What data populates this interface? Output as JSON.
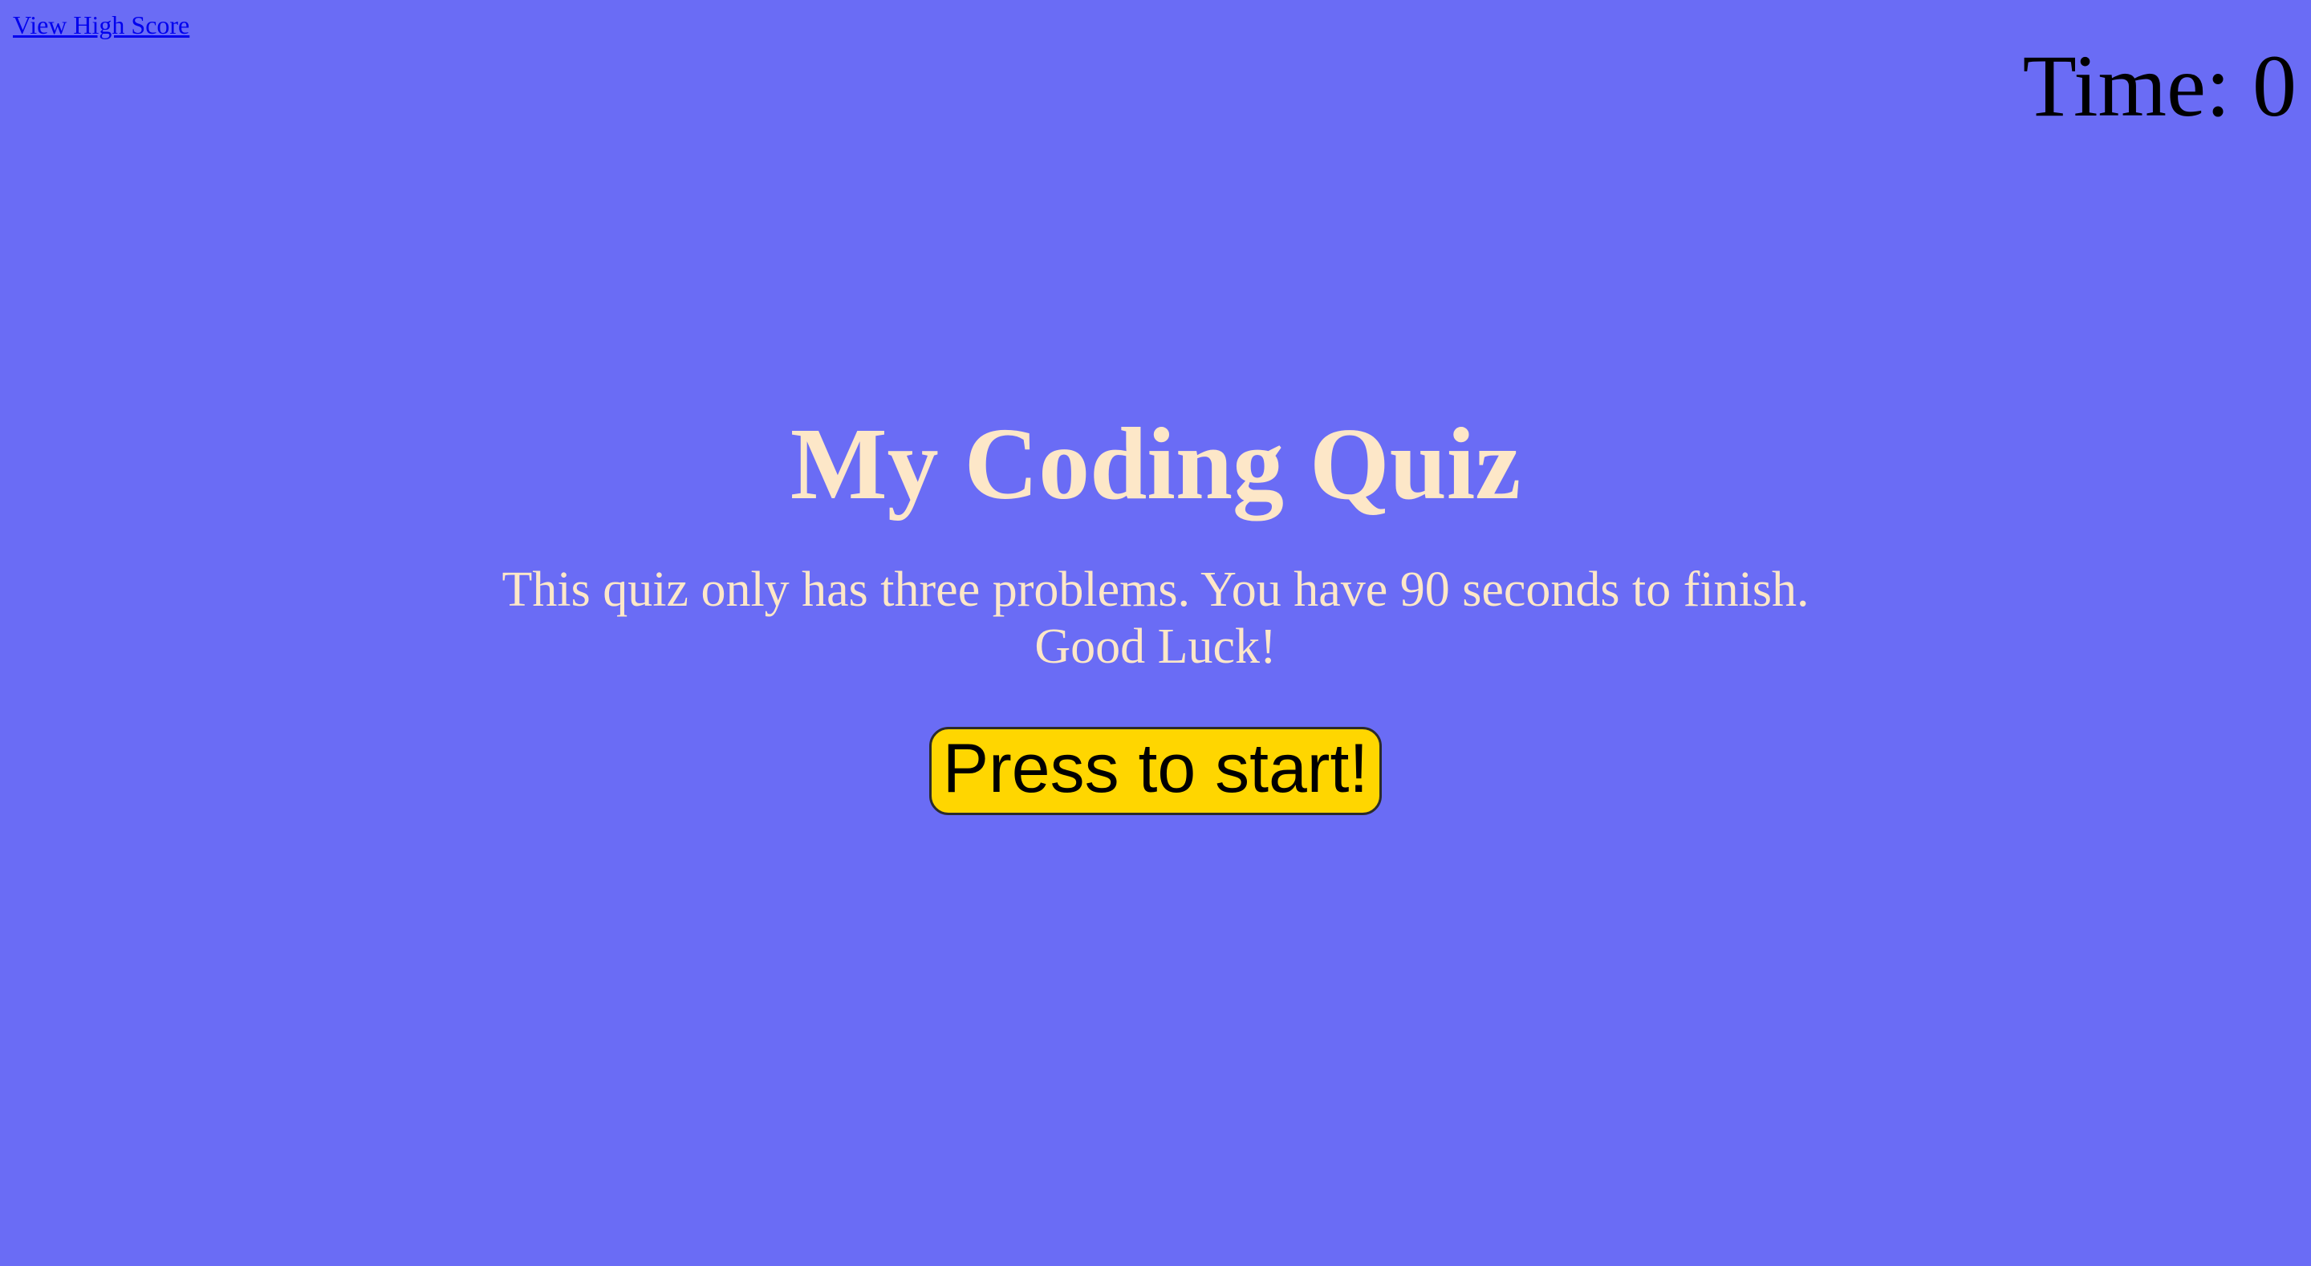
{
  "header": {
    "high_score_link": "View High Score",
    "timer": "Time: 0"
  },
  "intro": {
    "title": "My Coding Quiz",
    "description": "This quiz only has three problems. You have 90 seconds to finish. Good Luck!",
    "start_button": "Press to start!"
  },
  "colors": {
    "background": "#6a6cf5",
    "title_text": "#fde7c8",
    "button_fill": "#ffd600",
    "link": "#0000ee"
  }
}
